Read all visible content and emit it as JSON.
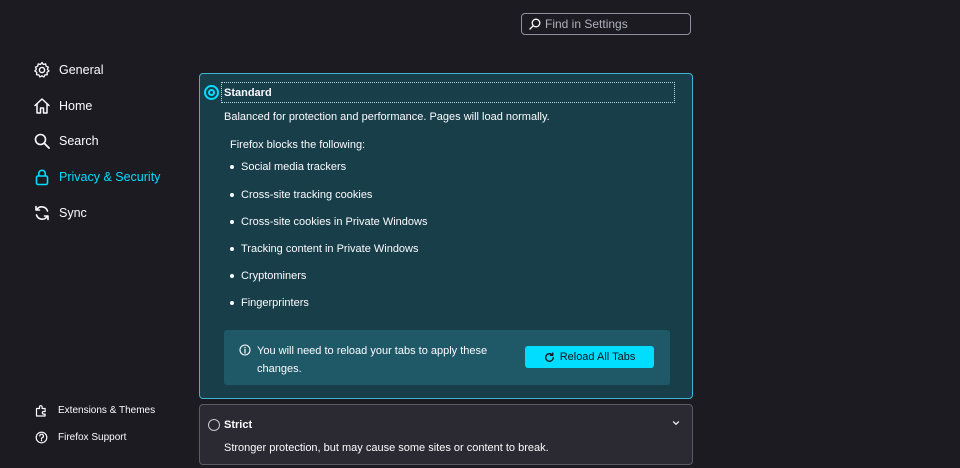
{
  "search": {
    "placeholder": "Find in Settings"
  },
  "sidebar": {
    "items": [
      {
        "label": "General",
        "icon": "gear-icon"
      },
      {
        "label": "Home",
        "icon": "home-icon"
      },
      {
        "label": "Search",
        "icon": "search-icon"
      },
      {
        "label": "Privacy & Security",
        "icon": "lock-icon",
        "selected": true
      },
      {
        "label": "Sync",
        "icon": "sync-icon"
      }
    ],
    "footer": [
      {
        "label": "Extensions & Themes",
        "icon": "puzzle-icon"
      },
      {
        "label": "Firefox Support",
        "icon": "help-icon"
      }
    ]
  },
  "standard": {
    "title": "Standard",
    "description": "Balanced for protection and performance. Pages will load normally.",
    "blocks_heading": "Firefox blocks the following:",
    "blocks": [
      "Social media trackers",
      "Cross-site tracking cookies",
      "Cross-site cookies in Private Windows",
      "Tracking content in Private Windows",
      "Cryptominers",
      "Fingerprinters"
    ],
    "reload_message": "You will need to reload your tabs to apply these changes.",
    "reload_button": "Reload All Tabs"
  },
  "strict": {
    "title": "Strict",
    "description": "Stronger protection, but may cause some sites or content to break."
  },
  "colors": {
    "accent": "#00ddff",
    "background": "#1c1b22",
    "selected_card": "#183e4a",
    "notice": "#1f5968"
  }
}
